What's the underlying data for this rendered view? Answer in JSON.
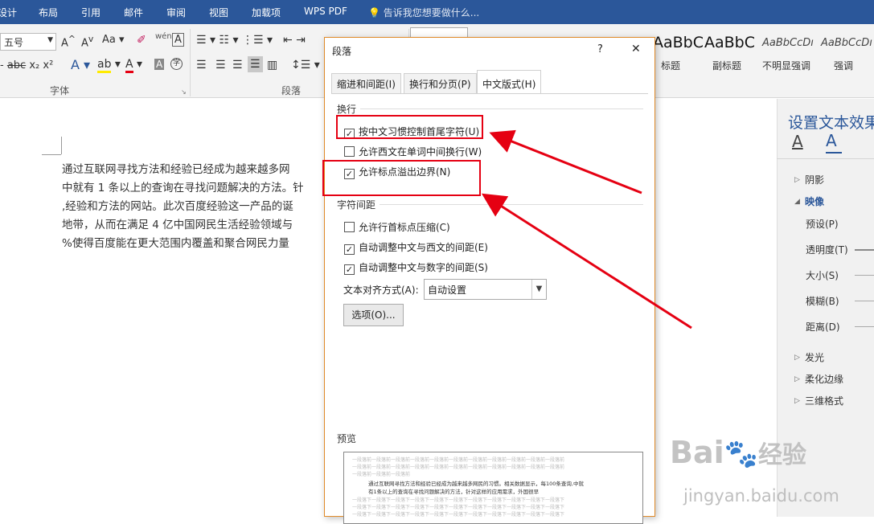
{
  "topbar": {
    "tabs": [
      "设计",
      "布局",
      "引用",
      "邮件",
      "审阅",
      "视图",
      "加载项",
      "WPS PDF"
    ],
    "tellme": "告诉我您想要做什么...",
    "tellme_icon": "lightbulb-icon"
  },
  "ribbon": {
    "font_size": "五号",
    "font_group": "字体",
    "para_group": "段落",
    "styles": [
      {
        "preview": "AaBbC",
        "label": "标题"
      },
      {
        "preview": "AaBbC",
        "label": "副标题"
      },
      {
        "preview": "AaBbCcDı",
        "label": "不明显强调"
      },
      {
        "preview": "AaBbCcDı",
        "label": "强调"
      }
    ]
  },
  "document": {
    "lines": [
      "通过互联网寻找方法和经验已经成为越来越多网",
      "中就有 1 条以上的查询在寻找问题解决的方法。针",
      ",经验和方法的网站。此次百度经验这一产品的诞",
      "地带，从而在满足 4 亿中国网民生活经验领域与",
      "%使得百度能在更大范围内覆盖和聚合网民力量"
    ]
  },
  "dialog": {
    "title": "段落",
    "help": "?",
    "close": "✕",
    "tabs": [
      "缩进和间距(I)",
      "换行和分页(P)",
      "中文版式(H)"
    ],
    "active_tab": 2,
    "section_wrap": "换行",
    "opt1": {
      "label": "按中文习惯控制首尾字符(U)",
      "checked": "✓"
    },
    "opt2": {
      "label": "允许西文在单词中间换行(W)",
      "checked": ""
    },
    "opt3": {
      "label": "允许标点溢出边界(N)",
      "checked": "✓"
    },
    "section_spacing": "字符间距",
    "opt4": {
      "label": "允许行首标点压缩(C)",
      "checked": ""
    },
    "opt5": {
      "label": "自动调整中文与西文的间距(E)",
      "checked": "✓"
    },
    "opt6": {
      "label": "自动调整中文与数字的间距(S)",
      "checked": "✓"
    },
    "align_label": "文本对齐方式(A):",
    "align_value": "自动设置",
    "options_button": "选项(O)...",
    "preview_label": "预览",
    "preview_text_1": "通过互联网寻找方法和经验已经成为越来越多网民的习惯。相关数据显示，每100条查询,中就",
    "preview_text_2": "有1条以上的查询在寻找问题解决的方法，针对这样的应用需求，外国很早"
  },
  "sidepanel": {
    "title": "设置文本效果",
    "sections": [
      "阴影",
      "映像",
      "发光",
      "柔化边缘",
      "三维格式"
    ],
    "controls": [
      "预设(P)",
      "透明度(T)",
      "大小(S)",
      "模糊(B)",
      "距离(D)"
    ]
  },
  "annotation": {
    "color": "#e50012"
  },
  "watermark": {
    "logo": "Bai",
    "logo2": "经验",
    "url": "jingyan.baidu.com"
  }
}
